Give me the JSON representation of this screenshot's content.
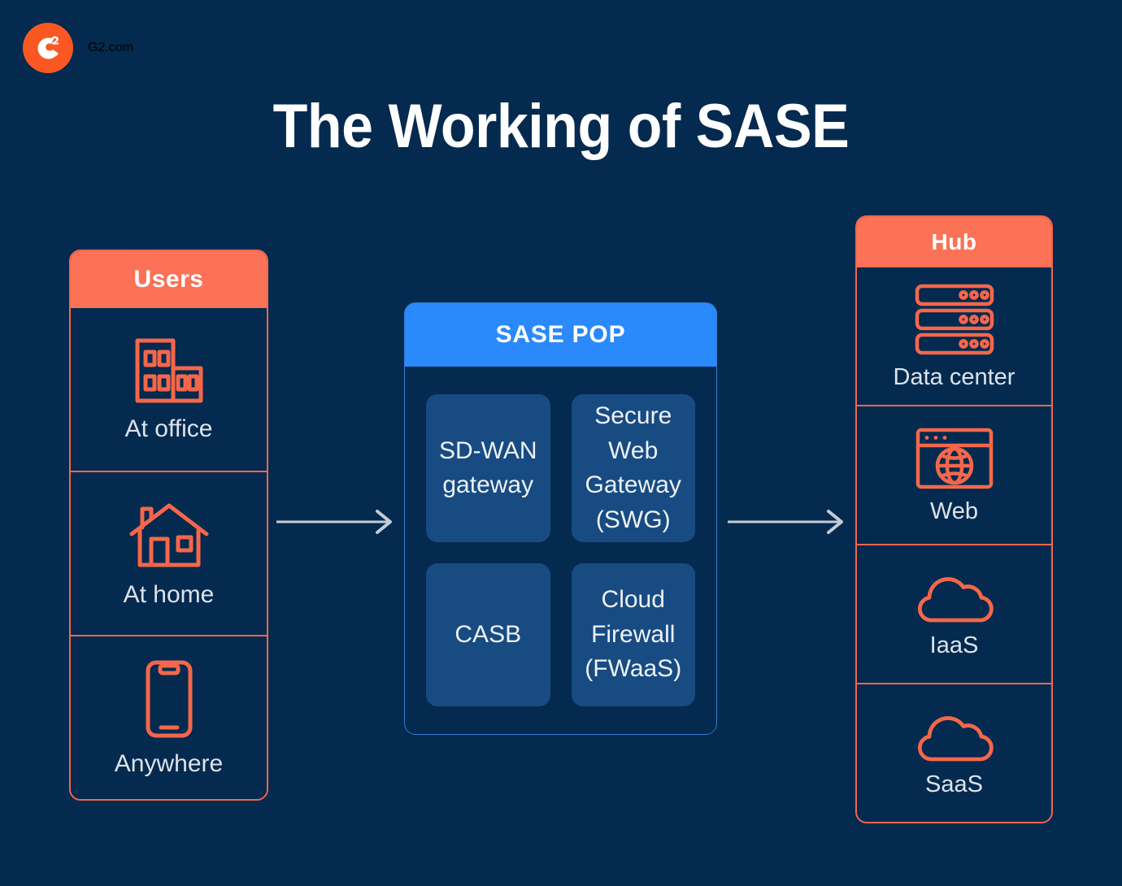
{
  "brand": {
    "logo_icon": "g2-logo-icon",
    "logo_mark": "G",
    "logo_superscript": "2",
    "name": "G2.com",
    "logo_color": "#fa5722"
  },
  "title": "The Working of SASE",
  "theme": {
    "background": "#042a4f",
    "accent_coral": "#fb7256",
    "accent_blue": "#2a8afb",
    "tile_blue": "#174b82",
    "label_text": "#dde3ea",
    "arrow_color": "#c3cdd6"
  },
  "users_column": {
    "header": "Users",
    "items": [
      {
        "label": "At office",
        "icon": "office-building-icon"
      },
      {
        "label": "At home",
        "icon": "house-icon"
      },
      {
        "label": "Anywhere",
        "icon": "smartphone-icon"
      }
    ]
  },
  "sase_pop": {
    "header": "SASE POP",
    "tiles": [
      {
        "label": "SD-WAN gateway",
        "lines": [
          "SD-WAN",
          "gateway"
        ]
      },
      {
        "label": "Secure Web Gateway (SWG)",
        "lines": [
          "Secure",
          "Web",
          "Gateway",
          "(SWG)"
        ]
      },
      {
        "label": "CASB",
        "lines": [
          "CASB"
        ]
      },
      {
        "label": "Cloud Firewall (FWaaS)",
        "lines": [
          "Cloud",
          "Firewall",
          "(FWaaS)"
        ]
      }
    ]
  },
  "hub_column": {
    "header": "Hub",
    "items": [
      {
        "label": "Data center",
        "icon": "server-rack-icon"
      },
      {
        "label": "Web",
        "icon": "browser-globe-icon"
      },
      {
        "label": "IaaS",
        "icon": "cloud-icon"
      },
      {
        "label": "SaaS",
        "icon": "cloud-icon"
      }
    ]
  },
  "arrows": [
    {
      "name": "users-to-sase-pop",
      "direction": "right"
    },
    {
      "name": "sase-pop-to-hub",
      "direction": "right"
    }
  ]
}
